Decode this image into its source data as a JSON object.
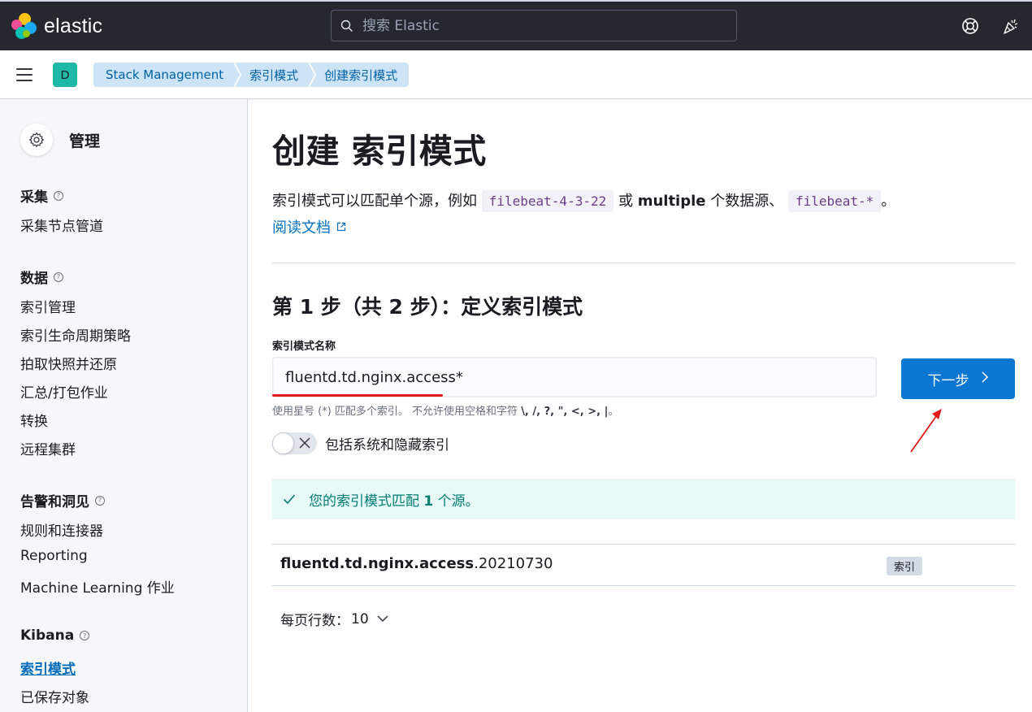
{
  "header": {
    "brand": "elastic",
    "search_placeholder": "搜索 Elastic",
    "icons": [
      "help-icon",
      "newsfeed-icon"
    ],
    "colors": {
      "bg": "#25282f",
      "logo_yellow": "#fec514",
      "logo_pink": "#f04e98",
      "logo_teal": "#00bfb3",
      "logo_blue": "#1ba9f5"
    }
  },
  "subbar": {
    "space_letter": "D",
    "breadcrumbs": [
      "Stack Management",
      "索引模式",
      "创建索引模式"
    ]
  },
  "sidebar": {
    "title": "管理",
    "groups": [
      {
        "title": "采集",
        "items": [
          "采集节点管道"
        ]
      },
      {
        "title": "数据",
        "items": [
          "索引管理",
          "索引生命周期策略",
          "拍取快照并还原",
          "汇总/打包作业",
          "转换",
          "远程集群"
        ]
      },
      {
        "title": "告警和洞见",
        "items": [
          "规则和连接器",
          "Reporting",
          "Machine Learning 作业"
        ]
      },
      {
        "title": "Kibana",
        "items": [
          "索引模式",
          "已保存对象"
        ]
      }
    ],
    "active_item": "索引模式"
  },
  "main": {
    "title": "创建 索引模式",
    "desc_part1": "索引模式可以匹配单个源，例如",
    "desc_code1": "filebeat-4-3-22",
    "desc_part2": "或",
    "desc_bold": "multiple",
    "desc_part3": "个数据源、",
    "desc_code2": "filebeat-*",
    "desc_part4": "。",
    "doc_link": "阅读文档",
    "step_title": "第 1 步（共 2 步）：定义索引模式",
    "field_label": "索引模式名称",
    "field_value": "fluentd.td.nginx.access*",
    "help_text": "使用星号 (*) 匹配多个索引。 不允许使用空格和字符",
    "help_chars": "\\, /, ?, \", <, >, |",
    "help_end": "。",
    "next_button": "下一步",
    "toggle_label": "包括系统和隐藏索引",
    "callout_prefix": "您的索引模式匹配",
    "callout_count": "1",
    "callout_suffix": "个源。",
    "result_bold": "fluentd.td.nginx.access",
    "result_rest": ".20210730",
    "result_badge": "索引",
    "rows_per_page_label": "每页行数：",
    "rows_per_page_value": "10",
    "colors": {
      "primary": "#0b77d2",
      "success_bg": "#e6f9f7",
      "success_text": "#017d73",
      "annotation_red": "#e21b1b"
    }
  }
}
